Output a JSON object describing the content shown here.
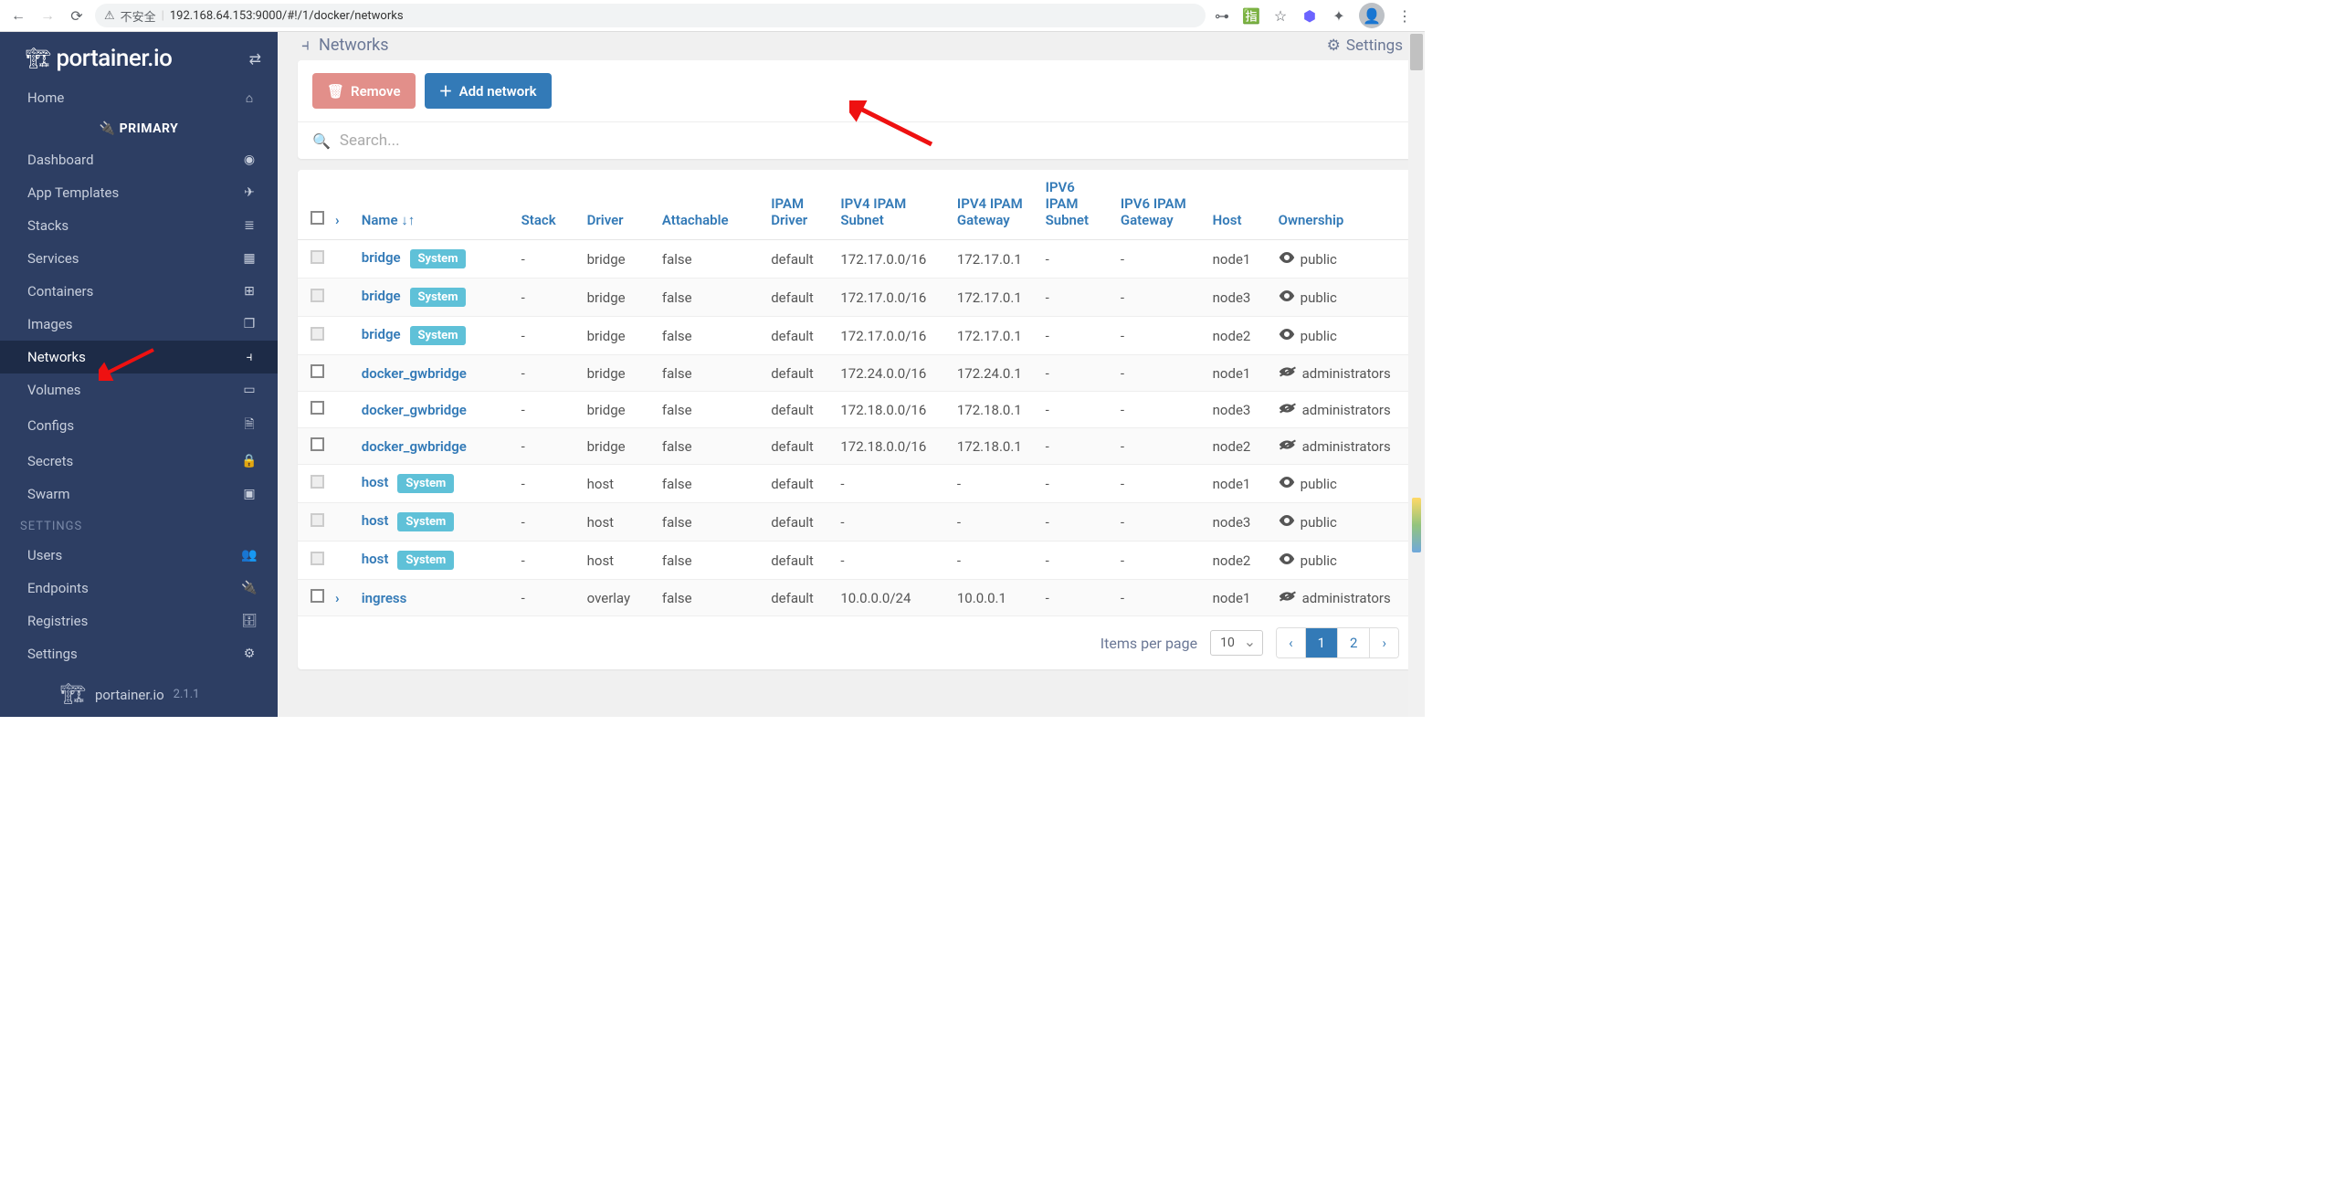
{
  "browser": {
    "url": "192.168.64.153:9000/#!/1/docker/networks",
    "insecure_label": "不安全"
  },
  "sidebar": {
    "logo": "portainer.io",
    "primary": "PRIMARY",
    "items": [
      {
        "label": "Home",
        "icon": "⌂"
      },
      {
        "label": "Dashboard",
        "icon": "◉"
      },
      {
        "label": "App Templates",
        "icon": "✈"
      },
      {
        "label": "Stacks",
        "icon": "≣"
      },
      {
        "label": "Services",
        "icon": "▦"
      },
      {
        "label": "Containers",
        "icon": "⊞"
      },
      {
        "label": "Images",
        "icon": "❐"
      },
      {
        "label": "Networks",
        "icon": "⫞"
      },
      {
        "label": "Volumes",
        "icon": "▭"
      },
      {
        "label": "Configs",
        "icon": "🗎"
      },
      {
        "label": "Secrets",
        "icon": "🔒"
      },
      {
        "label": "Swarm",
        "icon": "▣"
      }
    ],
    "settings_label": "SETTINGS",
    "settings_items": [
      {
        "label": "Users",
        "icon": "👥"
      },
      {
        "label": "Endpoints",
        "icon": "🔌"
      },
      {
        "label": "Registries",
        "icon": "🗄"
      },
      {
        "label": "Settings",
        "icon": "⚙"
      }
    ],
    "footer_logo": "portainer.io",
    "version": "2.1.1"
  },
  "header": {
    "breadcrumb_icon": "⫞",
    "breadcrumb": "Networks",
    "settings_label": "Settings"
  },
  "toolbar": {
    "remove_label": "Remove",
    "add_label": "Add network",
    "search_placeholder": "Search..."
  },
  "table": {
    "columns": [
      "Name",
      "Stack",
      "Driver",
      "Attachable",
      "IPAM Driver",
      "IPV4 IPAM Subnet",
      "IPV4 IPAM Gateway",
      "IPV6 IPAM Subnet",
      "IPV6 IPAM Gateway",
      "Host",
      "Ownership"
    ],
    "sort_indicator": "↓↑",
    "rows": [
      {
        "checkbox": "disabled",
        "expand": false,
        "name": "bridge",
        "system": true,
        "stack": "-",
        "driver": "bridge",
        "attachable": "false",
        "ipam_driver": "default",
        "v4subnet": "172.17.0.0/16",
        "v4gw": "172.17.0.1",
        "v6subnet": "-",
        "v6gw": "-",
        "host": "node1",
        "own_icon": "eye",
        "own": "public"
      },
      {
        "checkbox": "disabled",
        "expand": false,
        "name": "bridge",
        "system": true,
        "stack": "-",
        "driver": "bridge",
        "attachable": "false",
        "ipam_driver": "default",
        "v4subnet": "172.17.0.0/16",
        "v4gw": "172.17.0.1",
        "v6subnet": "-",
        "v6gw": "-",
        "host": "node3",
        "own_icon": "eye",
        "own": "public"
      },
      {
        "checkbox": "disabled",
        "expand": false,
        "name": "bridge",
        "system": true,
        "stack": "-",
        "driver": "bridge",
        "attachable": "false",
        "ipam_driver": "default",
        "v4subnet": "172.17.0.0/16",
        "v4gw": "172.17.0.1",
        "v6subnet": "-",
        "v6gw": "-",
        "host": "node2",
        "own_icon": "eye",
        "own": "public"
      },
      {
        "checkbox": "enabled",
        "expand": false,
        "name": "docker_gwbridge",
        "system": false,
        "stack": "-",
        "driver": "bridge",
        "attachable": "false",
        "ipam_driver": "default",
        "v4subnet": "172.24.0.0/16",
        "v4gw": "172.24.0.1",
        "v6subnet": "-",
        "v6gw": "-",
        "host": "node1",
        "own_icon": "slash",
        "own": "administrators"
      },
      {
        "checkbox": "enabled",
        "expand": false,
        "name": "docker_gwbridge",
        "system": false,
        "stack": "-",
        "driver": "bridge",
        "attachable": "false",
        "ipam_driver": "default",
        "v4subnet": "172.18.0.0/16",
        "v4gw": "172.18.0.1",
        "v6subnet": "-",
        "v6gw": "-",
        "host": "node3",
        "own_icon": "slash",
        "own": "administrators"
      },
      {
        "checkbox": "enabled",
        "expand": false,
        "name": "docker_gwbridge",
        "system": false,
        "stack": "-",
        "driver": "bridge",
        "attachable": "false",
        "ipam_driver": "default",
        "v4subnet": "172.18.0.0/16",
        "v4gw": "172.18.0.1",
        "v6subnet": "-",
        "v6gw": "-",
        "host": "node2",
        "own_icon": "slash",
        "own": "administrators"
      },
      {
        "checkbox": "disabled",
        "expand": false,
        "name": "host",
        "system": true,
        "stack": "-",
        "driver": "host",
        "attachable": "false",
        "ipam_driver": "default",
        "v4subnet": "-",
        "v4gw": "-",
        "v6subnet": "-",
        "v6gw": "-",
        "host": "node1",
        "own_icon": "eye",
        "own": "public"
      },
      {
        "checkbox": "disabled",
        "expand": false,
        "name": "host",
        "system": true,
        "stack": "-",
        "driver": "host",
        "attachable": "false",
        "ipam_driver": "default",
        "v4subnet": "-",
        "v4gw": "-",
        "v6subnet": "-",
        "v6gw": "-",
        "host": "node3",
        "own_icon": "eye",
        "own": "public"
      },
      {
        "checkbox": "disabled",
        "expand": false,
        "name": "host",
        "system": true,
        "stack": "-",
        "driver": "host",
        "attachable": "false",
        "ipam_driver": "default",
        "v4subnet": "-",
        "v4gw": "-",
        "v6subnet": "-",
        "v6gw": "-",
        "host": "node2",
        "own_icon": "eye",
        "own": "public"
      },
      {
        "checkbox": "enabled",
        "expand": true,
        "name": "ingress",
        "system": false,
        "stack": "-",
        "driver": "overlay",
        "attachable": "false",
        "ipam_driver": "default",
        "v4subnet": "10.0.0.0/24",
        "v4gw": "10.0.0.1",
        "v6subnet": "-",
        "v6gw": "-",
        "host": "node1",
        "own_icon": "slash",
        "own": "administrators"
      }
    ],
    "badge_label": "System"
  },
  "pagination": {
    "items_label": "Items per page",
    "per_page": "10",
    "prev": "‹",
    "pages": [
      "1",
      "2"
    ],
    "next": "›",
    "active_page": "1"
  }
}
